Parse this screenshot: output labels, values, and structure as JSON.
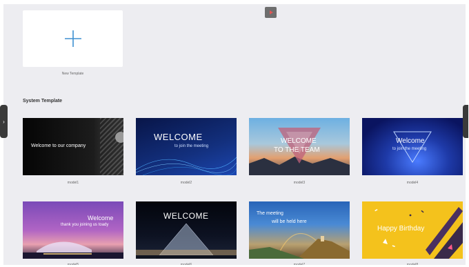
{
  "new_template": {
    "label": "New Template",
    "icon": "plus-icon"
  },
  "top_button": {
    "icon": "play-icon"
  },
  "section": {
    "title": "System Template"
  },
  "templates": [
    {
      "name": "model1",
      "line1": "Welcome to our company",
      "line2": "",
      "colors": [
        "#0c0c0c",
        "#3a3a3a"
      ]
    },
    {
      "name": "model2",
      "line1": "WELCOME",
      "line2": "to join the meeting",
      "colors": [
        "#0a1a5e",
        "#1c3d9e"
      ]
    },
    {
      "name": "model3",
      "line1": "WELCOME",
      "line2": "TO THE TEAM",
      "colors": [
        "#5aa0d6",
        "#e08a5a"
      ]
    },
    {
      "name": "model4",
      "line1": "Welcome",
      "line2": "to join the meeting",
      "colors": [
        "#0a1460",
        "#2a49c8"
      ]
    },
    {
      "name": "model5",
      "line1": "Welcome",
      "line2": "thank you joining us toady",
      "colors": [
        "#6a3fb0",
        "#d07ad0"
      ]
    },
    {
      "name": "model6",
      "line1": "WELCOME",
      "line2": "",
      "colors": [
        "#05070f",
        "#1a2238"
      ]
    },
    {
      "name": "model7",
      "line1": "The meeting",
      "line2": "will be held here",
      "colors": [
        "#2f7ac8",
        "#d88a3c"
      ]
    },
    {
      "name": "model8",
      "line1": "Happy Birthday",
      "line2": "",
      "colors": [
        "#f4c21c",
        "#f0a800"
      ]
    }
  ]
}
